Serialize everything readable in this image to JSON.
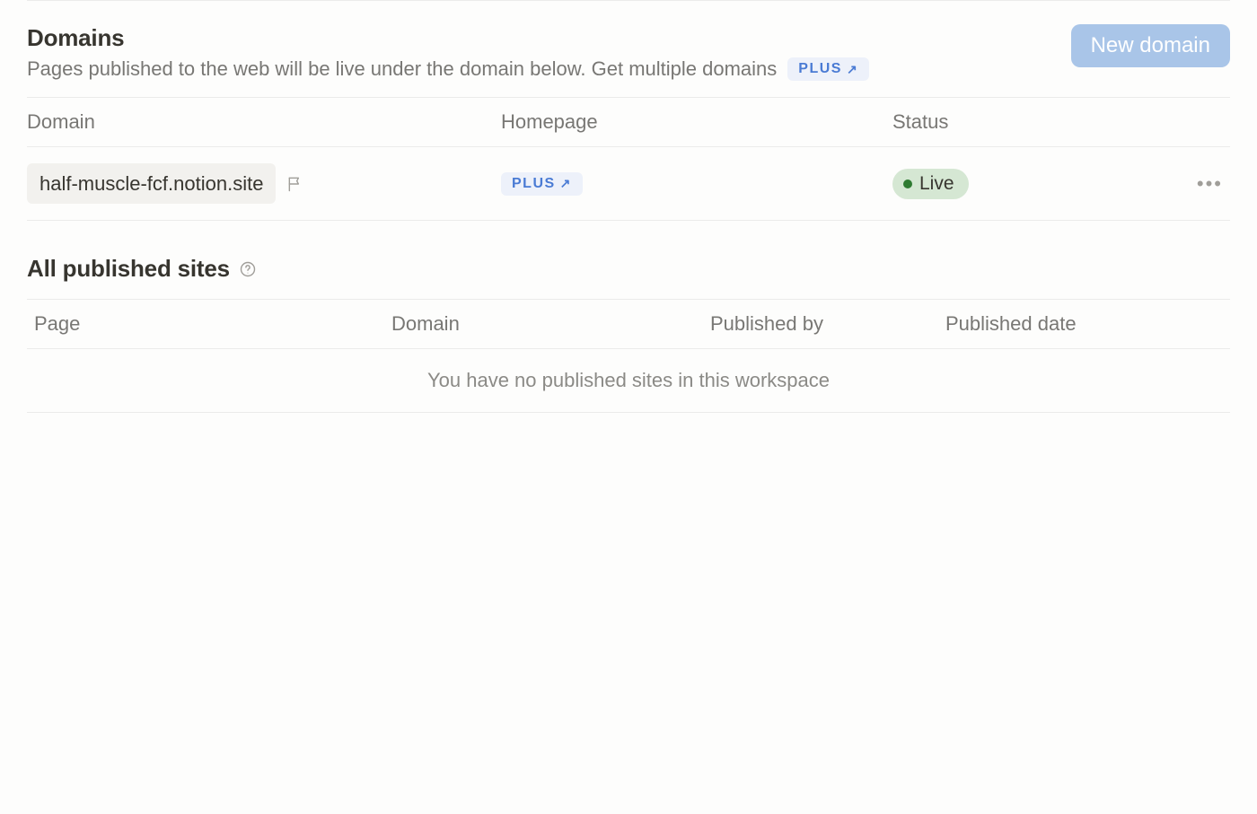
{
  "domains_section": {
    "title": "Domains",
    "subtitle": "Pages published to the web will be live under the domain below. Get multiple domains",
    "plus_badge": "PLUS",
    "new_domain_button": "New domain",
    "columns": {
      "domain": "Domain",
      "homepage": "Homepage",
      "status": "Status"
    },
    "rows": [
      {
        "domain": "half-muscle-fcf.notion.site",
        "homepage_badge": "PLUS",
        "status": "Live"
      }
    ]
  },
  "published_sites": {
    "title": "All published sites",
    "columns": {
      "page": "Page",
      "domain": "Domain",
      "published_by": "Published by",
      "published_date": "Published date"
    },
    "empty_message": "You have no published sites in this workspace"
  }
}
